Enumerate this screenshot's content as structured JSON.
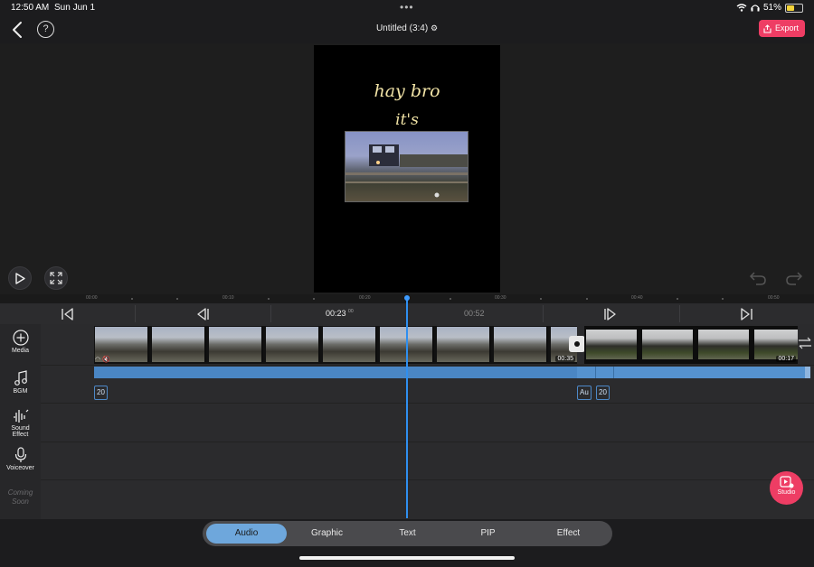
{
  "status_bar": {
    "time": "12:50 AM",
    "date": "Sun Jun 1",
    "battery": "51%",
    "battery_level": 0.51
  },
  "header": {
    "title": "Untitled (3:4)",
    "export_label": "Export"
  },
  "preview": {
    "caption_line1": "hay bro",
    "caption_line2": "it's"
  },
  "ruler": {
    "labels": [
      "00:00",
      "00:10",
      "00:20",
      "00:30",
      "00:40",
      "00:50"
    ]
  },
  "controls": {
    "current_time": "00:23",
    "current_frame": "00",
    "total_time": "00:52"
  },
  "tracks": {
    "media_label": "Media",
    "bgm_label": "BGM",
    "sound_effect_label": "Sound Effect",
    "voiceover_label": "Voiceover",
    "coming_soon_label": "Coming Soon",
    "clip1_duration": "00:35",
    "clip2_duration": "00:17",
    "audio_tag1": "20",
    "audio_tag2": "Au",
    "audio_tag3": "20"
  },
  "studio_label": "Studio",
  "tabs": [
    {
      "label": "Audio",
      "active": true
    },
    {
      "label": "Graphic",
      "active": false
    },
    {
      "label": "Text",
      "active": false
    },
    {
      "label": "PIP",
      "active": false
    },
    {
      "label": "Effect",
      "active": false
    }
  ],
  "colors": {
    "accent": "#ee3d64",
    "playhead": "#2f8fef",
    "audio": "#4a86c4",
    "active_tab": "#6ea7dc"
  }
}
